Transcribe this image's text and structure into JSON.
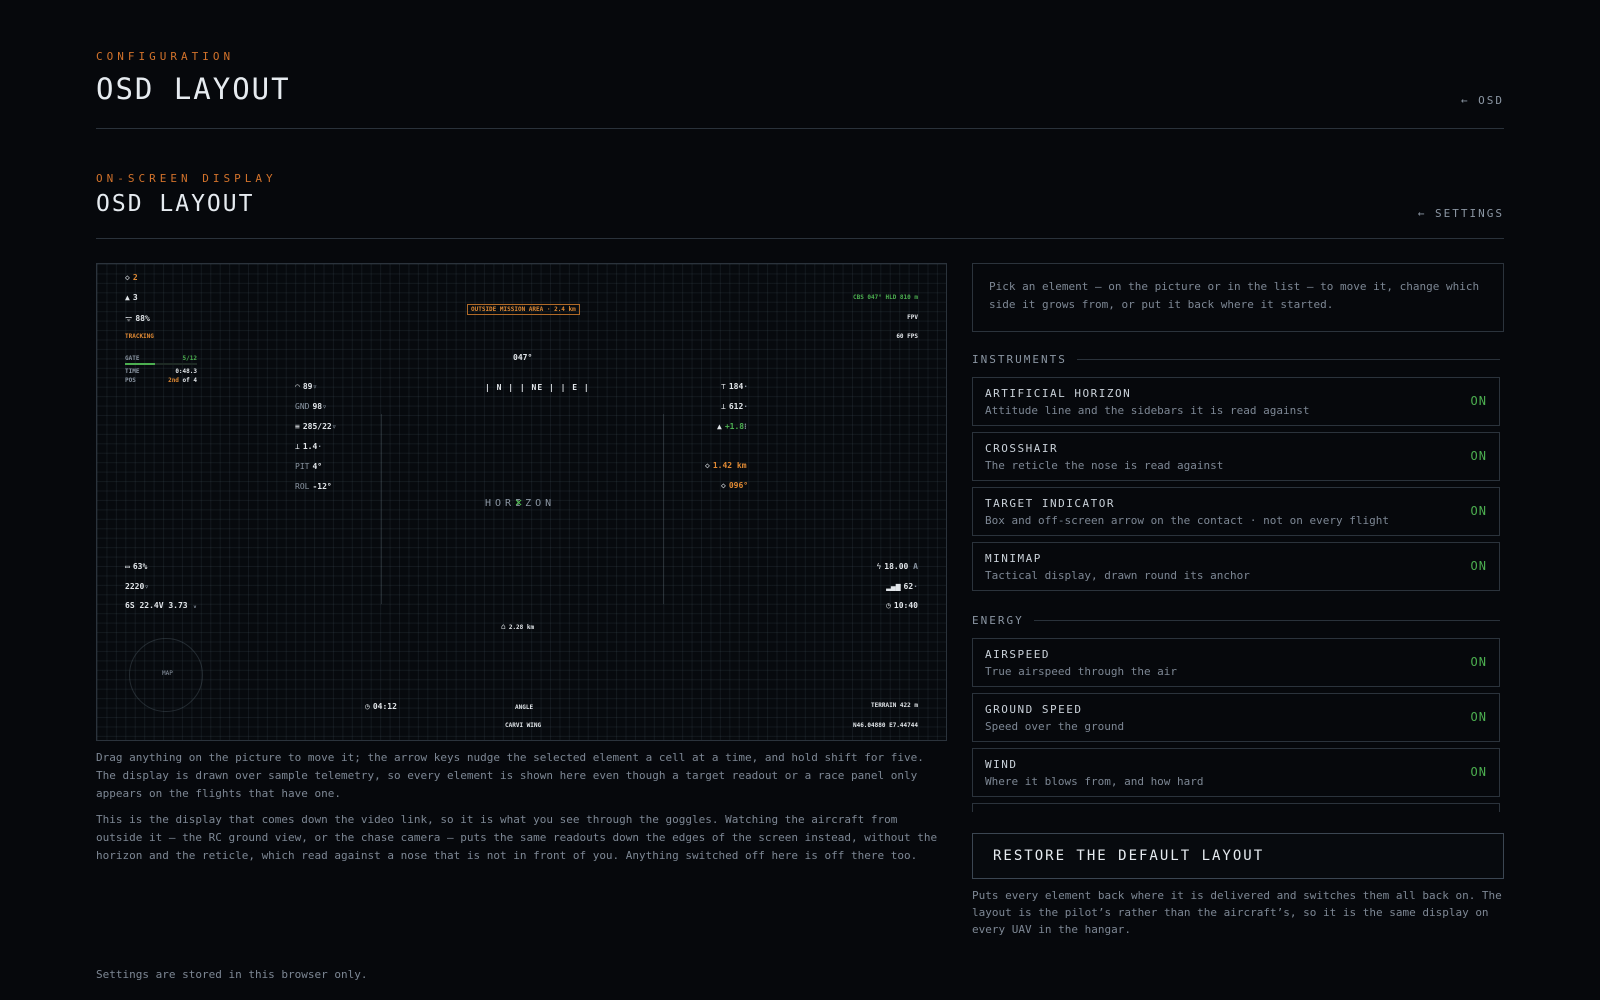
{
  "page": {
    "eyebrow": "CONFIGURATION",
    "title": "OSD LAYOUT",
    "back_label": "← OSD"
  },
  "section": {
    "eyebrow": "ON-SCREEN DISPLAY",
    "title": "OSD LAYOUT",
    "back_label": "← SETTINGS"
  },
  "osd": {
    "sats": "2",
    "uavs": "3",
    "link": "88%",
    "tracking": "TRACKING",
    "race_gate_label": "GATE",
    "race_gate_value": "5/12",
    "race_gate_progress": 0.42,
    "race_time_label": "TIME",
    "race_time_value": "0:48.3",
    "race_pos_label": "POS",
    "race_pos_value": "2nd",
    "race_pos_of": "of 4",
    "mission_warning": "OUTSIDE MISSION AREA · 2.4 km",
    "cbs": "CBS 047° HLD 810 m",
    "fpv": "FPV",
    "fps": "60 FPS",
    "heading": "047°",
    "compass": "| N | | NE | | E |",
    "throttle": "89",
    "gnd_label": "GND",
    "gnd_speed": "98",
    "wind": "285/22",
    "sink": "1.4",
    "pit_label": "PIT",
    "pitch": "4°",
    "rol_label": "ROL",
    "roll": "-12°",
    "alt": "184",
    "alt_home": "612",
    "vario": "+1.8",
    "target_dist": "1.42 km",
    "target_bearing": "096°",
    "horizon_text": "HORIZON",
    "battery_pct": "63%",
    "mah": "2220",
    "cells": "6S 22.4V",
    "cell_v": "3.73",
    "current": "18.00",
    "rssi": "62",
    "flight_time": "10:40",
    "home_dist": "2.28 km",
    "timer": "04:12",
    "mode": "ANGLE",
    "aircraft": "CARVI WING",
    "terrain": "TERRAIN 422 m",
    "coords": "N46.04880 E7.44744",
    "map_label": "MAP"
  },
  "captions": {
    "p1": "Drag anything on the picture to move it; the arrow keys nudge the selected element a cell at a time, and hold shift for five. The display is drawn over sample telemetry, so every element is shown here even though a target readout or a race panel only appears on the flights that have one.",
    "p2": "This is the display that comes down the video link, so it is what you see through the goggles. Watching the aircraft from outside it — the RC ground view, or the chase camera — puts the same readouts down the edges of the screen instead, without the horizon and the reticle, which read against a nose that is not in front of you. Anything switched off here is off there too."
  },
  "hint": "Pick an element — on the picture or in the list — to move it, change which side it grows from, or put it back where it started.",
  "groups": {
    "instruments": "INSTRUMENTS",
    "energy": "ENERGY"
  },
  "items": [
    {
      "name": "ARTIFICIAL HORIZON",
      "desc": "Attitude line and the sidebars it is read against",
      "state": "ON"
    },
    {
      "name": "CROSSHAIR",
      "desc": "The reticle the nose is read against",
      "state": "ON"
    },
    {
      "name": "TARGET INDICATOR",
      "desc": "Box and off-screen arrow on the contact · not on every flight",
      "state": "ON"
    },
    {
      "name": "MINIMAP",
      "desc": "Tactical display, drawn round its anchor",
      "state": "ON"
    },
    {
      "name": "AIRSPEED",
      "desc": "True airspeed through the air",
      "state": "ON"
    },
    {
      "name": "GROUND SPEED",
      "desc": "Speed over the ground",
      "state": "ON"
    },
    {
      "name": "WIND",
      "desc": "Where it blows from, and how hard",
      "state": "ON"
    }
  ],
  "restore": {
    "label": "RESTORE THE DEFAULT LAYOUT",
    "note": "Puts every element back where it is delivered and switches them all back on. The layout is the pilot’s rather than the aircraft’s, so it is the same display on every UAV in the hangar."
  },
  "footer": "Settings are stored in this browser only.",
  "colors": {
    "accent": "#d2722b",
    "on": "#4caf50",
    "background": "#06080c"
  }
}
